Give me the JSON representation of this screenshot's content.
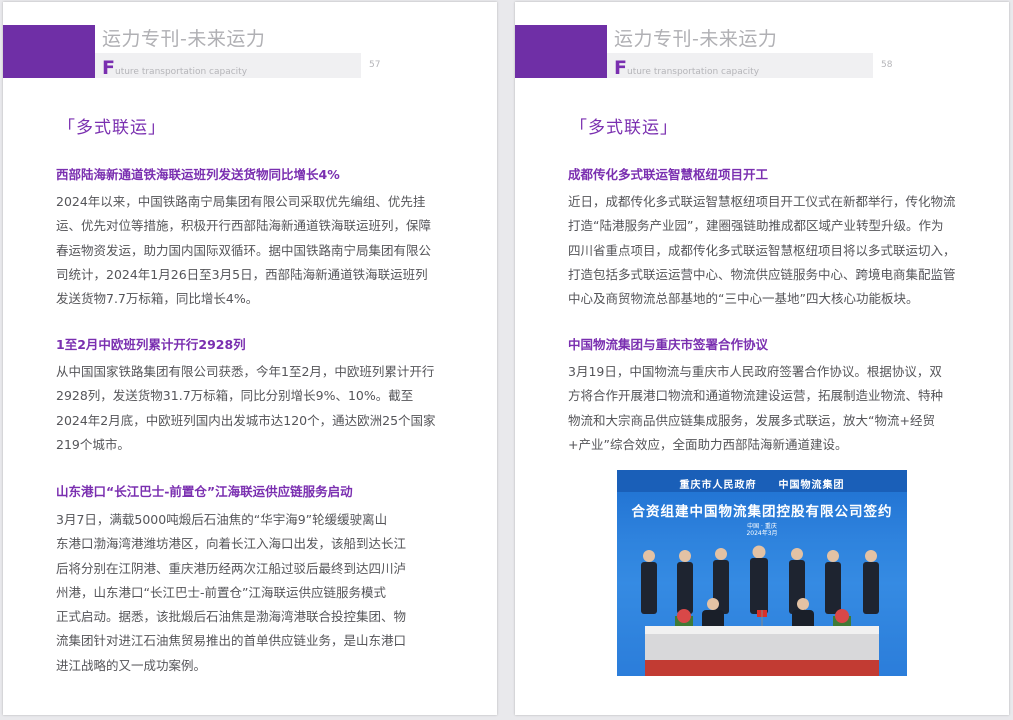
{
  "header": {
    "title": "运力专刊-未来运力",
    "subtitle_initial": "F",
    "subtitle_rest": "uture transportation capacity",
    "brand_color": "#6f2fa6"
  },
  "left_page": {
    "page_number": "57",
    "section_tag": "「多式联运」",
    "articles": [
      {
        "title": "西部陆海新通道铁海联运班列发送货物同比增长4%",
        "lines": [
          "2024年以来，中国铁路南宁局集团有限公司采取优先编组、优先挂",
          "运、优先对位等措施，积极开行西部陆海新通道铁海联运班列，保障",
          "春运物资发运，助力国内国际双循环。据中国铁路南宁局集团有限公",
          "司统计，2024年1月26日至3月5日，西部陆海新通道铁海联运班列",
          "发送货物7.7万标箱，同比增长4%。"
        ]
      },
      {
        "title": "1至2月中欧班列累计开行2928列",
        "lines": [
          "从中国国家铁路集团有限公司获悉，今年1至2月，中欧班列累计开行",
          "2928列，发送货物31.7万标箱，同比分别增长9%、10%。截至",
          "2024年2月底，中欧班列国内出发城市达120个，通达欧洲25个国家",
          "219个城市。"
        ]
      },
      {
        "title": "山东港口“长江巴士-前置仓”江海联运供应链服务启动",
        "lines": [
          "3月7日，满载5000吨煅后石油焦的“华宇海9”轮缓缓驶离山",
          "东港口渤海湾港潍坊港区，向着长江入海口出发，该船到达长江",
          "后将分别在江阴港、重庆港历经两次江船过驳后最终到达四川泸",
          "州港，山东港口“长江巴士-前置仓”江海联运供应链服务模式",
          "正式启动。据悉，该批煅后石油焦是渤海湾港联合投控集团、物",
          "流集团针对进江石油焦贸易推出的首单供应链业务，是山东港口",
          "进江战略的又一成功案例。"
        ]
      }
    ]
  },
  "right_page": {
    "page_number": "58",
    "section_tag": "「多式联运」",
    "articles": [
      {
        "title": "成都传化多式联运智慧枢纽项目开工",
        "lines": [
          "近日，成都传化多式联运智慧枢纽项目开工仪式在新都举行，传化物流",
          "打造“陆港服务产业园”，建圈强链助推成都区域产业转型升级。作为",
          "四川省重点项目，成都传化多式联运智慧枢纽项目将以多式联运切入，",
          "打造包括多式联运运营中心、物流供应链服务中心、跨境电商集配监管",
          "中心及商贸物流总部基地的“三中心一基地”四大核心功能板块。"
        ]
      },
      {
        "title": "中国物流集团与重庆市签署合作协议",
        "lines": [
          "3月19日，中国物流与重庆市人民政府签署合作协议。根据协议，双",
          "方将合作开展港口物流和通道物流建设运营，拓展制造业物流、特种",
          "物流和大宗商品供应链集成服务，发展多式联运，放大“物流+经贸",
          "+产业”综合效应，全面助力西部陆海新通道建设。"
        ]
      }
    ],
    "photo": {
      "org_line": "重庆市人民政府　　中国物流集团",
      "headline": "合资组建中国物流集团控股有限公司签约",
      "place": "中国 · 重庆",
      "date": "2024年3月",
      "backdrop_color": "#2a7ad9"
    }
  }
}
